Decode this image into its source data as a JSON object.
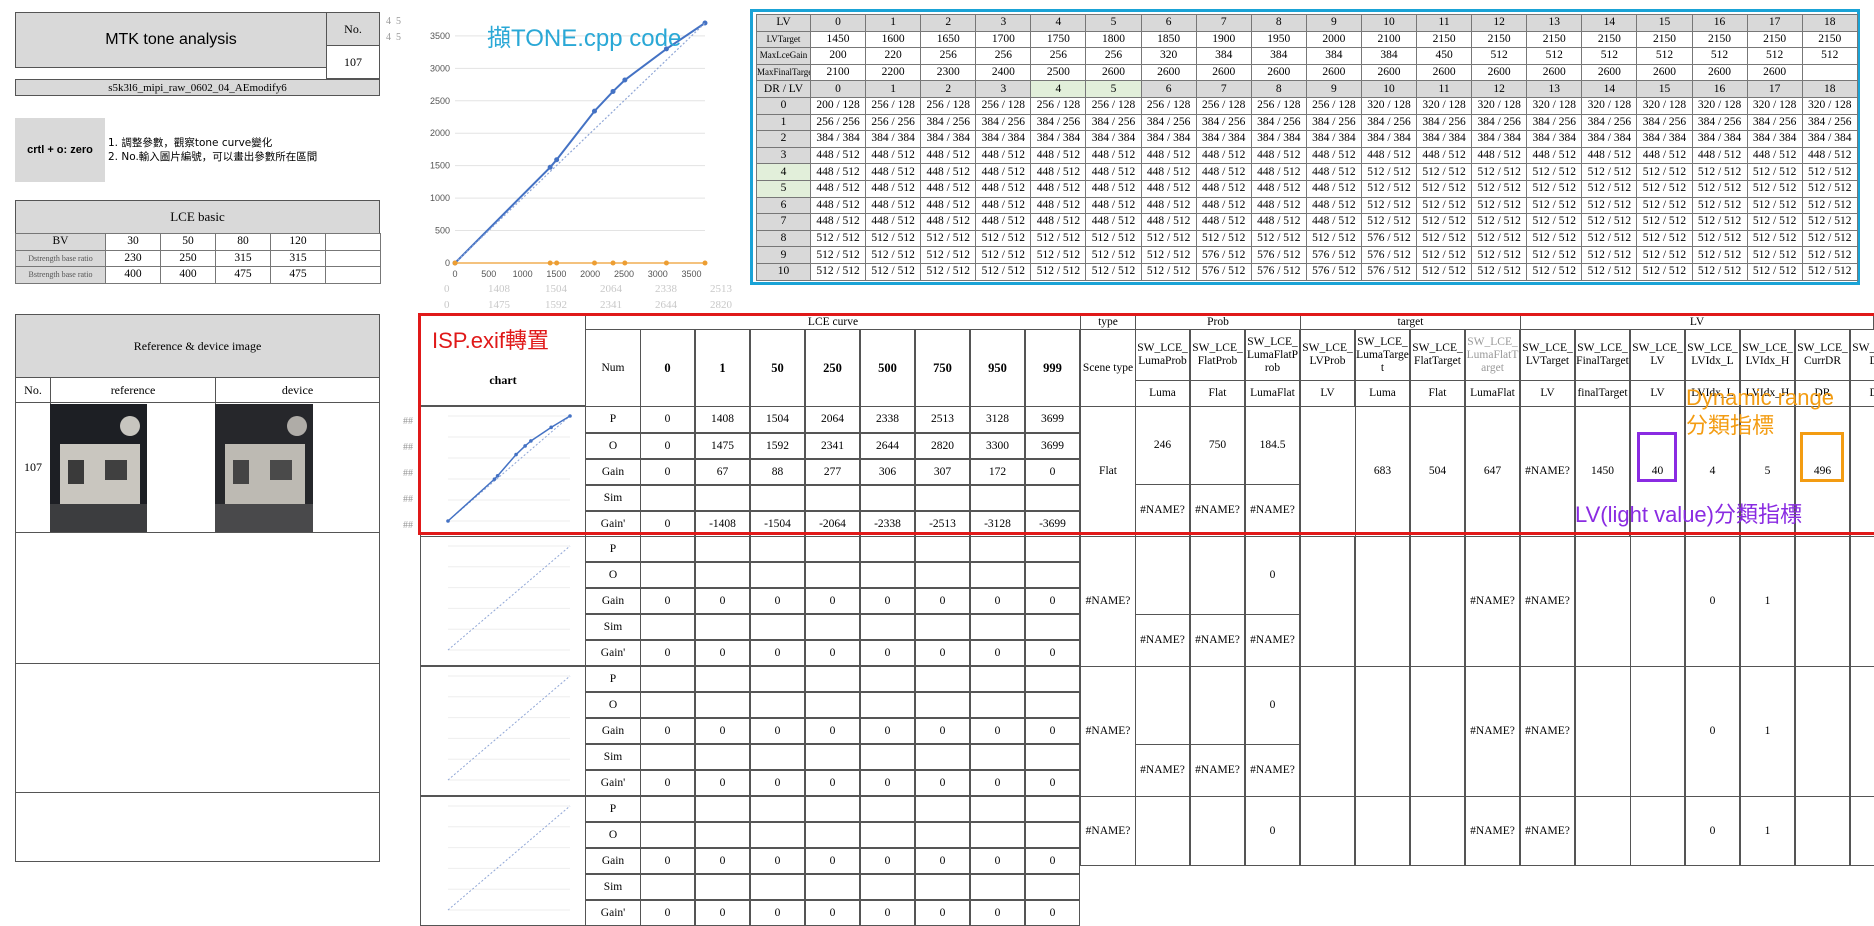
{
  "title_box": {
    "title": "MTK tone analysis",
    "no_label": "No.",
    "no_value": "107",
    "subtitle": "s5k3l6_mipi_raw_0602_04_AEmodify6"
  },
  "hint": {
    "key": "crtl + o: zero",
    "line1": "1. 調整參數，觀察tone curve變化",
    "line2": "2. No.輸入圖片編號，可以畫出參數所在區間"
  },
  "lce_basic": {
    "title": "LCE basic",
    "header": [
      "BV",
      "30",
      "50",
      "80",
      "120"
    ],
    "rows": [
      [
        "Dstrength base ratio",
        "230",
        "250",
        "315",
        "315"
      ],
      [
        "Bstrength base ratio",
        "400",
        "400",
        "475",
        "475"
      ]
    ]
  },
  "ref": {
    "title": "Reference & device image",
    "col_no": "No.",
    "col_ref": "reference",
    "col_dev": "device",
    "row_no": "107"
  },
  "annotations": {
    "tone_cpp": "擷TONE.cpp code",
    "isp_exif": "ISP.exif轉置",
    "dynamic_range": "Dynamic range\n分類指標",
    "lv_index": "LV(light value)分類指標"
  },
  "top_chart": {
    "x_ticks": [
      "0",
      "500",
      "1000",
      "1500",
      "2000",
      "2500",
      "3000",
      "3500"
    ],
    "y_ticks": [
      "0",
      "500",
      "1000",
      "1500",
      "2000",
      "2500",
      "3000",
      "3500"
    ],
    "under_row1": [
      "0",
      "1408",
      "1504",
      "2064",
      "2338",
      "2513",
      "3128",
      "3699"
    ],
    "under_row2": [
      "0",
      "1475",
      "1592",
      "2341",
      "2644",
      "2820",
      "3300",
      "3699"
    ]
  },
  "chart_data": [
    {
      "type": "line",
      "series": [
        {
          "x": [
            0,
            1408,
            1504,
            2064,
            2338,
            2513,
            3128,
            3699
          ],
          "y": [
            0,
            1475,
            1592,
            2341,
            2644,
            2820,
            3300,
            3699
          ]
        },
        {
          "x": [
            0,
            3699
          ],
          "y": [
            0,
            3699
          ]
        },
        {
          "x": [
            0,
            1408,
            1504,
            2064,
            2338,
            2513,
            3128,
            3699
          ],
          "y": [
            0,
            0,
            0,
            0,
            0,
            0,
            0,
            0
          ]
        }
      ],
      "xlim": [
        0,
        3699
      ],
      "ylim": [
        0,
        3699
      ]
    }
  ],
  "lv_table": {
    "lv_header": [
      "LV",
      "0",
      "1",
      "2",
      "3",
      "4",
      "5",
      "6",
      "7",
      "8",
      "9",
      "10",
      "11",
      "12",
      "13",
      "14",
      "15",
      "16",
      "17",
      "18"
    ],
    "lv_target": [
      "LVTarget",
      "1450",
      "1600",
      "1650",
      "1700",
      "1750",
      "1800",
      "1850",
      "1900",
      "1950",
      "2000",
      "2100",
      "2150",
      "2150",
      "2150",
      "2150",
      "2150",
      "2150",
      "2150",
      "2150"
    ],
    "max_lce_gain": [
      "MaxLceGain",
      "200",
      "220",
      "256",
      "256",
      "256",
      "256",
      "320",
      "384",
      "384",
      "384",
      "384",
      "450",
      "512",
      "512",
      "512",
      "512",
      "512",
      "512",
      "512"
    ],
    "max_final_target": [
      "MaxFinalTarget",
      "2100",
      "2200",
      "2300",
      "2400",
      "2500",
      "2600",
      "2600",
      "2600",
      "2600",
      "2600",
      "2600",
      "2600",
      "2600",
      "2600",
      "2600",
      "2600",
      "2600",
      "2600",
      ""
    ],
    "dr_header": [
      "DR / LV",
      "0",
      "1",
      "2",
      "3",
      "4",
      "5",
      "6",
      "7",
      "8",
      "9",
      "10",
      "11",
      "12",
      "13",
      "14",
      "15",
      "16",
      "17",
      "18"
    ],
    "dr_rows": [
      [
        "0",
        "200 / 128",
        "256 / 128",
        "256 / 128",
        "256 / 128",
        "256 / 128",
        "256 / 128",
        "256 / 128",
        "256 / 128",
        "256 / 128",
        "256 / 128",
        "320 / 128",
        "320 / 128",
        "320 / 128",
        "320 / 128",
        "320 / 128",
        "320 / 128",
        "320 / 128",
        "320 / 128",
        "320 / 128"
      ],
      [
        "1",
        "256 / 256",
        "256 / 256",
        "384 / 256",
        "384 / 256",
        "384 / 256",
        "384 / 256",
        "384 / 256",
        "384 / 256",
        "384 / 256",
        "384 / 256",
        "384 / 256",
        "384 / 256",
        "384 / 256",
        "384 / 256",
        "384 / 256",
        "384 / 256",
        "384 / 256",
        "384 / 256",
        "384 / 256"
      ],
      [
        "2",
        "384 / 384",
        "384 / 384",
        "384 / 384",
        "384 / 384",
        "384 / 384",
        "384 / 384",
        "384 / 384",
        "384 / 384",
        "384 / 384",
        "384 / 384",
        "384 / 384",
        "384 / 384",
        "384 / 384",
        "384 / 384",
        "384 / 384",
        "384 / 384",
        "384 / 384",
        "384 / 384",
        "384 / 384"
      ],
      [
        "3",
        "448 / 512",
        "448 / 512",
        "448 / 512",
        "448 / 512",
        "448 / 512",
        "448 / 512",
        "448 / 512",
        "448 / 512",
        "448 / 512",
        "448 / 512",
        "448 / 512",
        "448 / 512",
        "448 / 512",
        "448 / 512",
        "448 / 512",
        "448 / 512",
        "448 / 512",
        "448 / 512",
        "448 / 512"
      ],
      [
        "4",
        "448 / 512",
        "448 / 512",
        "448 / 512",
        "448 / 512",
        "448 / 512",
        "448 / 512",
        "448 / 512",
        "448 / 512",
        "448 / 512",
        "448 / 512",
        "512 / 512",
        "512 / 512",
        "512 / 512",
        "512 / 512",
        "512 / 512",
        "512 / 512",
        "512 / 512",
        "512 / 512",
        "512 / 512"
      ],
      [
        "5",
        "448 / 512",
        "448 / 512",
        "448 / 512",
        "448 / 512",
        "448 / 512",
        "448 / 512",
        "448 / 512",
        "448 / 512",
        "448 / 512",
        "448 / 512",
        "512 / 512",
        "512 / 512",
        "512 / 512",
        "512 / 512",
        "512 / 512",
        "512 / 512",
        "512 / 512",
        "512 / 512",
        "512 / 512"
      ],
      [
        "6",
        "448 / 512",
        "448 / 512",
        "448 / 512",
        "448 / 512",
        "448 / 512",
        "448 / 512",
        "448 / 512",
        "448 / 512",
        "448 / 512",
        "448 / 512",
        "512 / 512",
        "512 / 512",
        "512 / 512",
        "512 / 512",
        "512 / 512",
        "512 / 512",
        "512 / 512",
        "512 / 512",
        "512 / 512"
      ],
      [
        "7",
        "448 / 512",
        "448 / 512",
        "448 / 512",
        "448 / 512",
        "448 / 512",
        "448 / 512",
        "448 / 512",
        "448 / 512",
        "448 / 512",
        "448 / 512",
        "512 / 512",
        "512 / 512",
        "512 / 512",
        "512 / 512",
        "512 / 512",
        "512 / 512",
        "512 / 512",
        "512 / 512",
        "512 / 512"
      ],
      [
        "8",
        "512 / 512",
        "512 / 512",
        "512 / 512",
        "512 / 512",
        "512 / 512",
        "512 / 512",
        "512 / 512",
        "512 / 512",
        "512 / 512",
        "512 / 512",
        "576 / 512",
        "512 / 512",
        "512 / 512",
        "512 / 512",
        "512 / 512",
        "512 / 512",
        "512 / 512",
        "512 / 512",
        "512 / 512"
      ],
      [
        "9",
        "512 / 512",
        "512 / 512",
        "512 / 512",
        "512 / 512",
        "512 / 512",
        "512 / 512",
        "512 / 512",
        "576 / 512",
        "576 / 512",
        "576 / 512",
        "576 / 512",
        "512 / 512",
        "512 / 512",
        "512 / 512",
        "512 / 512",
        "512 / 512",
        "512 / 512",
        "512 / 512",
        "512 / 512"
      ],
      [
        "10",
        "512 / 512",
        "512 / 512",
        "512 / 512",
        "512 / 512",
        "512 / 512",
        "512 / 512",
        "512 / 512",
        "576 / 512",
        "576 / 512",
        "576 / 512",
        "576 / 512",
        "512 / 512",
        "512 / 512",
        "512 / 512",
        "512 / 512",
        "512 / 512",
        "512 / 512",
        "512 / 512",
        "512 / 512"
      ]
    ]
  },
  "lce": {
    "title": "LCE curve",
    "chart": "chart",
    "num": "Num",
    "points": [
      "0",
      "1",
      "50",
      "250",
      "500",
      "750",
      "950",
      "999"
    ],
    "type_h": "type",
    "prob_h": "Prob",
    "target_h": "target",
    "lv_h": "LV",
    "scene_type": "Scene type",
    "sw_cols": [
      "SW_LCE_LumaProb",
      "SW_LCE_FlatProb",
      "SW_LCE_LumaFlatProb",
      "SW_LCE_LVProb",
      "SW_LCE_LumaTarget",
      "SW_LCE_FlatTarget",
      "SW_LCE_LumaFlatTarget",
      "SW_LCE_LVTarget",
      "SW_LCE_FinalTarget",
      "SW_LCE_LV",
      "SW_LCE_LVIdx_L",
      "SW_LCE_LVIdx_H",
      "SW_LCE_CurrDR",
      "SW_LCE_DR"
    ],
    "sub_cols": [
      "Luma",
      "Flat",
      "LumaFlat",
      "LV",
      "Luma",
      "Flat",
      "LumaFlat",
      "LV",
      "finalTarget",
      "LV",
      "LVIdx_L",
      "LVIdx_H",
      "DR",
      "DR"
    ],
    "row_labels": [
      "P",
      "O",
      "Gain",
      "Sim",
      "Gain'"
    ],
    "r1": {
      "P": [
        "0",
        "1408",
        "1504",
        "2064",
        "2338",
        "2513",
        "3128",
        "3699"
      ],
      "O": [
        "0",
        "1475",
        "1592",
        "2341",
        "2644",
        "2820",
        "3300",
        "3699"
      ],
      "Gain": [
        "0",
        "67",
        "88",
        "277",
        "306",
        "307",
        "172",
        "0"
      ],
      "GainP": [
        "0",
        "-1408",
        "-1504",
        "-2064",
        "-2338",
        "-2513",
        "-3128",
        "-3699"
      ],
      "scene": "Flat",
      "prob": [
        "246",
        "750",
        "184.5",
        "#NAME?"
      ],
      "prob2": [
        "#NAME?",
        "#NAME?",
        "#NAME?",
        "#NAME?"
      ],
      "target": [
        "683",
        "504",
        "647",
        "#NAME?",
        "1450"
      ],
      "lv": [
        "40",
        "4",
        "5",
        "496"
      ]
    },
    "rz": {
      "zeros": [
        "0",
        "0",
        "0",
        "0",
        "0",
        "0",
        "0",
        "0"
      ],
      "scene": "#NAME?",
      "lumaflat": "0",
      "lvprob": "#NAME?",
      "prob2": [
        "#NAME?",
        "#NAME?",
        "#NAME?",
        "#NAME?"
      ],
      "lvt": "#NAME?",
      "final": "#NAME?",
      "idx_l": "0",
      "idx_h": "1"
    }
  }
}
